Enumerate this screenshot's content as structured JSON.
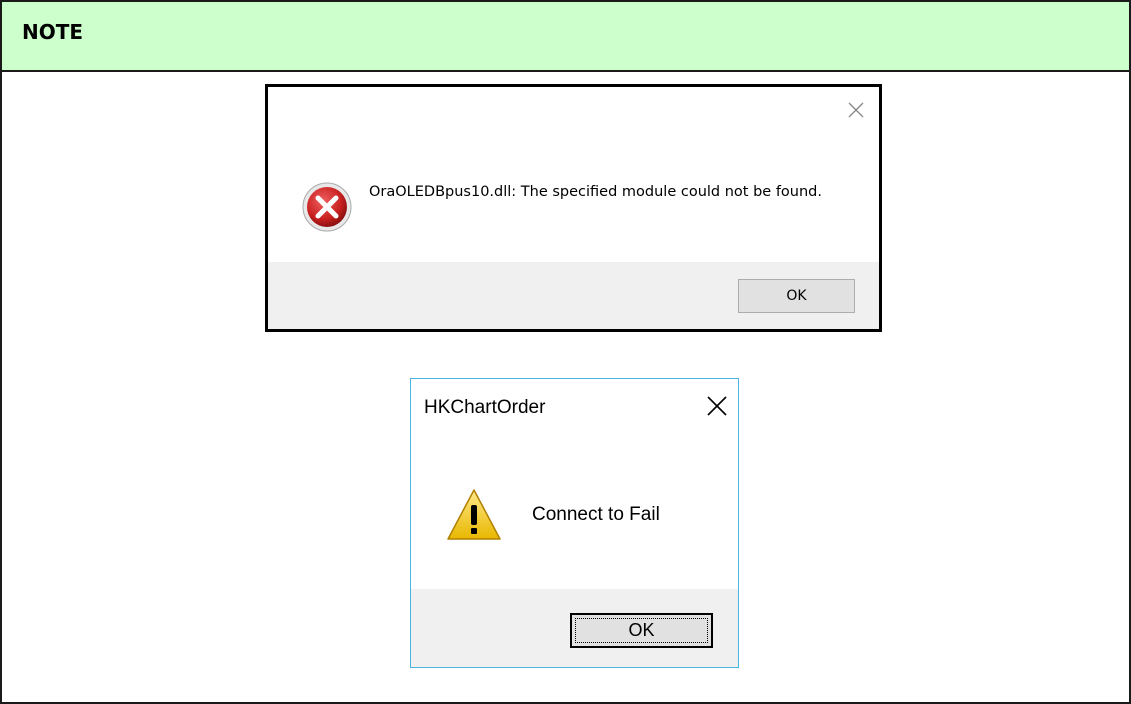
{
  "note": {
    "title": "NOTE"
  },
  "dialog_error": {
    "message": "OraOLEDBpus10.dll:  The specified module could not be found.",
    "ok_label": "OK",
    "icon": "error-icon",
    "close_icon": "close-icon"
  },
  "dialog_warning": {
    "title": "HKChartOrder",
    "message": "Connect to Fail",
    "ok_label": "OK",
    "icon": "warning-icon",
    "close_icon": "close-icon"
  },
  "colors": {
    "note_header_bg": "#ccffcc",
    "dialog_footer_bg": "#f0f0f0",
    "dialog2_border": "#4cb4e0",
    "error_red": "#d03030",
    "warning_yellow": "#f7d22a"
  }
}
